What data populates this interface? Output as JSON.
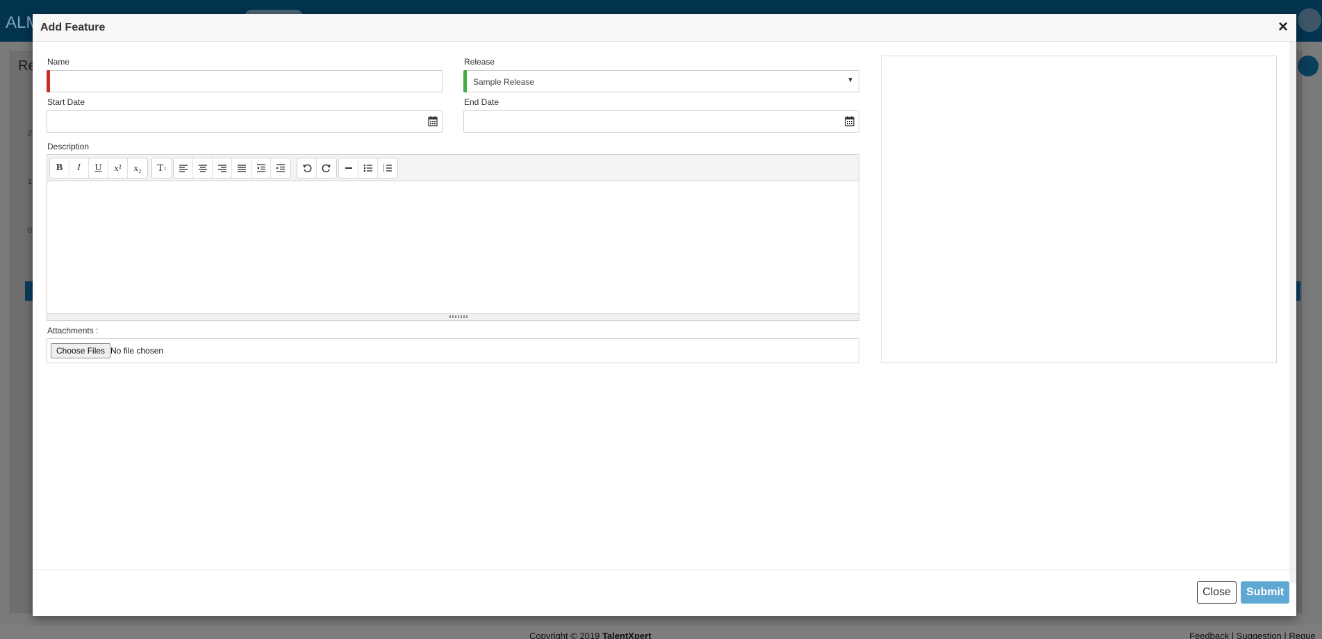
{
  "background": {
    "logo": "ALM",
    "page_title": "Re",
    "ticks": [
      "2",
      "1",
      "0"
    ],
    "footer_copyright": "Copyright © 2019",
    "footer_brand": "TalentXpert",
    "footer_links": "Feedback | Suggestion | Reque"
  },
  "modal": {
    "title": "Add Feature",
    "close_symbol": "×",
    "name": {
      "label": "Name",
      "value": ""
    },
    "release": {
      "label": "Release",
      "value": "Sample Release"
    },
    "start_date": {
      "label": "Start Date",
      "value": ""
    },
    "end_date": {
      "label": "End Date",
      "value": ""
    },
    "description": {
      "label": "Description",
      "toolbar": [
        "bold",
        "italic",
        "underline",
        "superscript",
        "subscript",
        "text-size",
        "align-left",
        "align-center",
        "align-right",
        "justify",
        "outdent",
        "indent",
        "undo",
        "redo",
        "horizontal-rule",
        "bullet-list",
        "numbered-list"
      ]
    },
    "attachments": {
      "label": "Attachments :",
      "button": "Choose Files",
      "status": "No file chosen"
    },
    "footer": {
      "close_label": "Close",
      "submit_label": "Submit"
    }
  },
  "colors": {
    "header_bg": "#02334f",
    "required_indicator": "#c9302c",
    "valid_indicator": "#3cb043",
    "submit_bg": "#5fa8d3"
  }
}
